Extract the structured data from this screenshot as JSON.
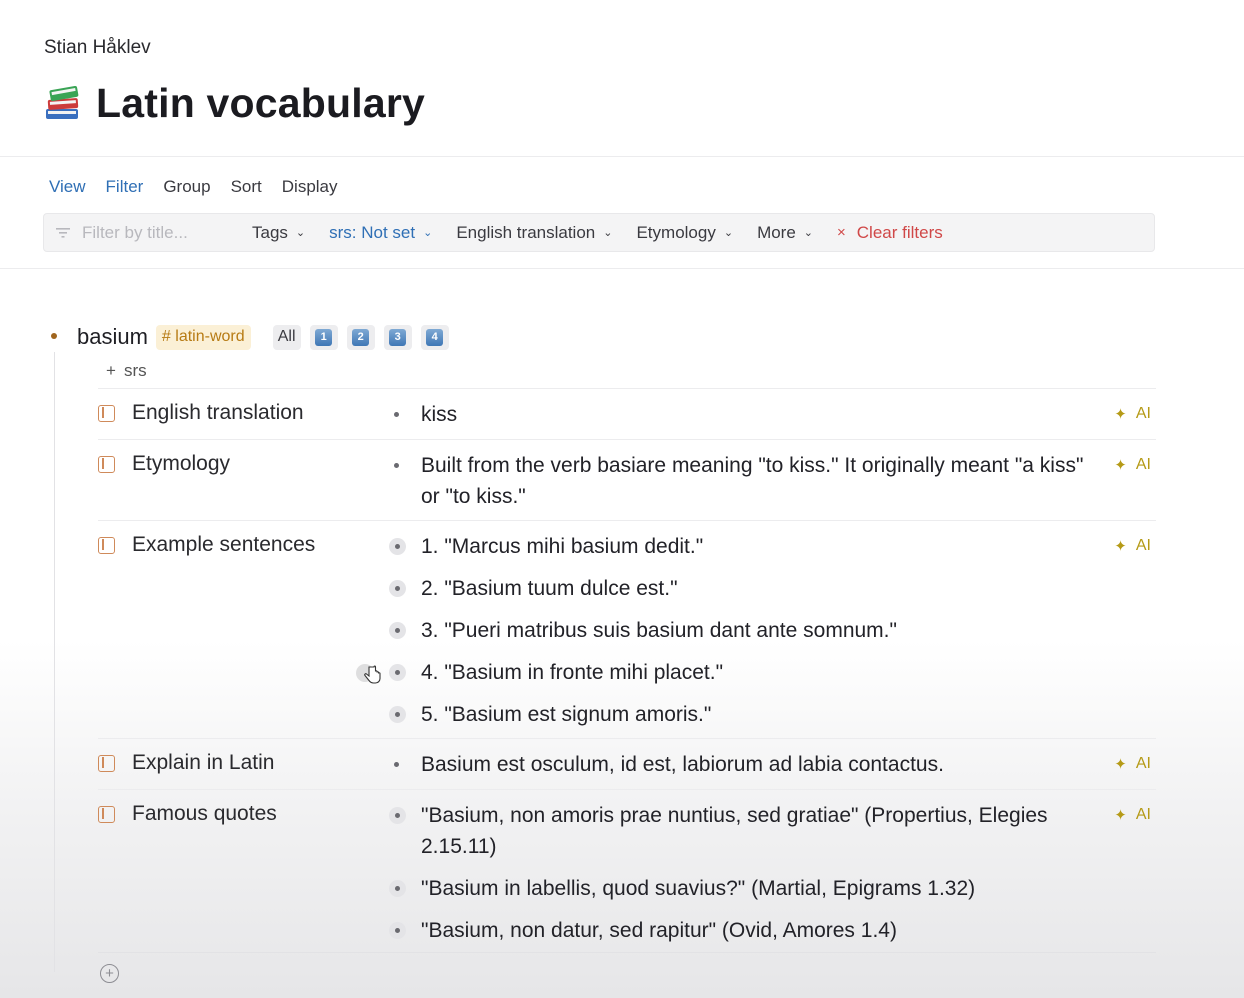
{
  "header": {
    "author": "Stian Håklev",
    "title": "Latin vocabulary",
    "title_icon": "books-emoji-icon"
  },
  "view_tabs": [
    {
      "label": "View",
      "active": true
    },
    {
      "label": "Filter",
      "active": true
    },
    {
      "label": "Group",
      "active": false
    },
    {
      "label": "Sort",
      "active": false
    },
    {
      "label": "Display",
      "active": false
    }
  ],
  "filter_bar": {
    "placeholder": "Filter by title...",
    "chips": {
      "tags": "Tags",
      "srs": "srs: Not set",
      "english": "English translation",
      "etymology": "Etymology",
      "more": "More"
    },
    "clear_label": "Clear filters"
  },
  "node": {
    "word": "basium",
    "tag": "# latin-word",
    "buttons": [
      "All",
      "1",
      "2",
      "3",
      "4"
    ],
    "add_label": "srs",
    "ai_label": "AI",
    "fields": [
      {
        "label": "English translation",
        "values": [
          "kiss"
        ],
        "ring": false
      },
      {
        "label": "Etymology",
        "values": [
          "Built from the verb basiare meaning \"to kiss.\" It originally meant \"a kiss\" or \"to kiss.\""
        ],
        "ring": false
      },
      {
        "label": "Example sentences",
        "values": [
          "1. \"Marcus mihi basium dedit.\"",
          "2. \"Basium tuum dulce est.\"",
          "3. \"Pueri matribus suis basium dant ante somnum.\"",
          "4. \"Basium in fronte mihi placet.\"",
          "5. \"Basium est signum amoris.\""
        ],
        "ring": true
      },
      {
        "label": "Explain in Latin",
        "values": [
          "Basium est osculum, id est, labiorum ad labia contactus."
        ],
        "ring": false
      },
      {
        "label": "Famous quotes",
        "values": [
          "\"Basium, non amoris prae nuntius, sed gratiae\" (Propertius, Elegies 2.15.11)",
          "\"Basium in labellis, quod suavius?\" (Martial, Epigrams 1.32)",
          "\"Basium, non datur, sed rapitur\" (Ovid, Amores 1.4)"
        ],
        "ring": true
      }
    ]
  },
  "colors": {
    "accent_blue": "#2f6fb5",
    "clear_red": "#d04848",
    "tag_text": "#b77b14",
    "ai_gold": "#b59a16",
    "field_icon": "#cf8a5a"
  }
}
